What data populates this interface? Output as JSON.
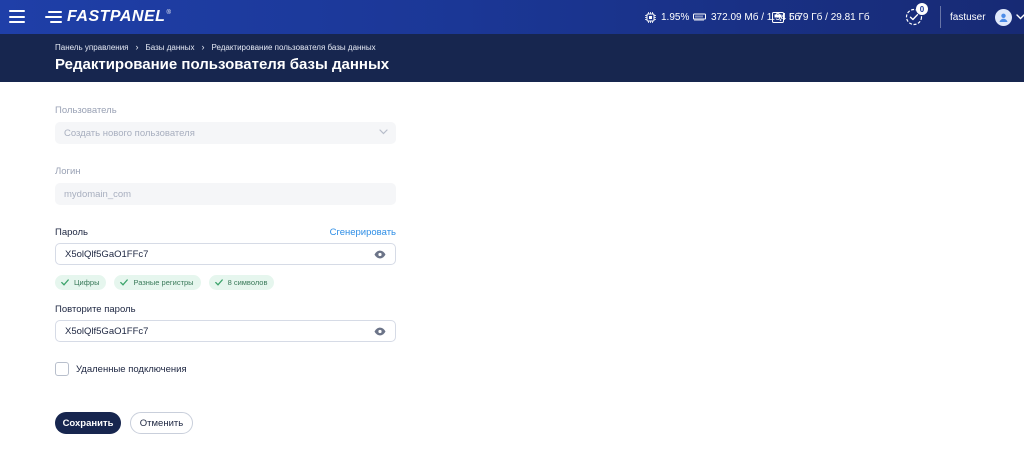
{
  "topbar": {
    "logo_text": "FASTPANEL",
    "logo_mark": "®",
    "cpu": "1.95%",
    "memory": "372.09 Мб / 1.94 Гб",
    "disk": "5.79 Гб / 29.81 Гб",
    "tasks_count": "0",
    "username": "fastuser"
  },
  "header": {
    "breadcrumbs": [
      "Панель управления",
      "Базы данных",
      "Редактирование пользователя базы данных"
    ],
    "breadcrumb_separator": "›",
    "title": "Редактирование пользователя базы данных"
  },
  "form": {
    "user_label": "Пользователь",
    "user_select_value": "Создать нового пользователя",
    "login_label": "Логин",
    "login_value": "mydomain_com",
    "password_label": "Пароль",
    "generate_label": "Сгенерировать",
    "password_value": "X5olQlf5GaO1FFc7",
    "checks": [
      "Цифры",
      "Разные регистры",
      "8 символов"
    ],
    "repeat_label": "Повторите пароль",
    "repeat_value": "X5olQlf5GaO1FFc7",
    "remote_label": "Удаленные подключения",
    "remote_checked": false,
    "save_label": "Сохранить",
    "cancel_label": "Отменить"
  },
  "colors": {
    "topbar": "#1f3fa8",
    "header": "#17264f",
    "link": "#2e8ee6",
    "chip_bg": "#e6f6ee",
    "chip_text": "#3a7a5a"
  },
  "icons": [
    "menu-icon",
    "logo-icon",
    "cpu-icon",
    "memory-icon",
    "disk-icon",
    "tasks-check-icon",
    "user-avatar-icon",
    "chevron-down-icon",
    "eye-icon",
    "check-icon"
  ]
}
